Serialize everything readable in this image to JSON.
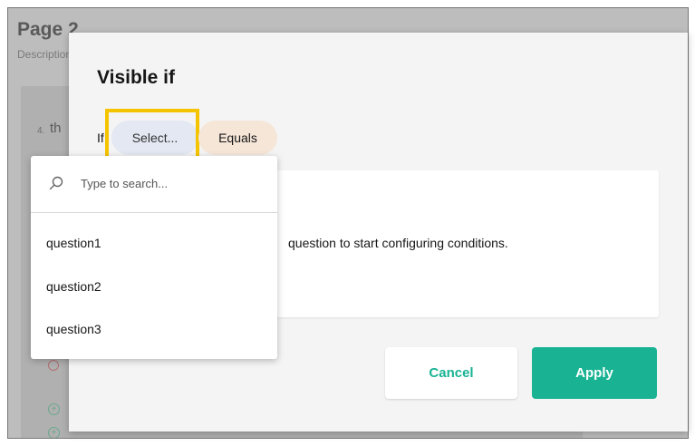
{
  "background_page": {
    "title": "Page 2",
    "description": "Description",
    "question_number": "4.",
    "question_title_partial": "th"
  },
  "modal": {
    "title": "Visible if",
    "if_label": "If",
    "select_placeholder": "Select...",
    "operator": "Equals",
    "info_text": "question to start configuring conditions.",
    "cancel_label": "Cancel",
    "apply_label": "Apply"
  },
  "dropdown": {
    "search_placeholder": "Type to search...",
    "options": [
      "question1",
      "question2",
      "question3"
    ]
  },
  "colors": {
    "accent": "#19b394",
    "highlight": "#f5c400",
    "select_pill": "#e3e8f2",
    "operator_pill": "#f6e6d8"
  }
}
